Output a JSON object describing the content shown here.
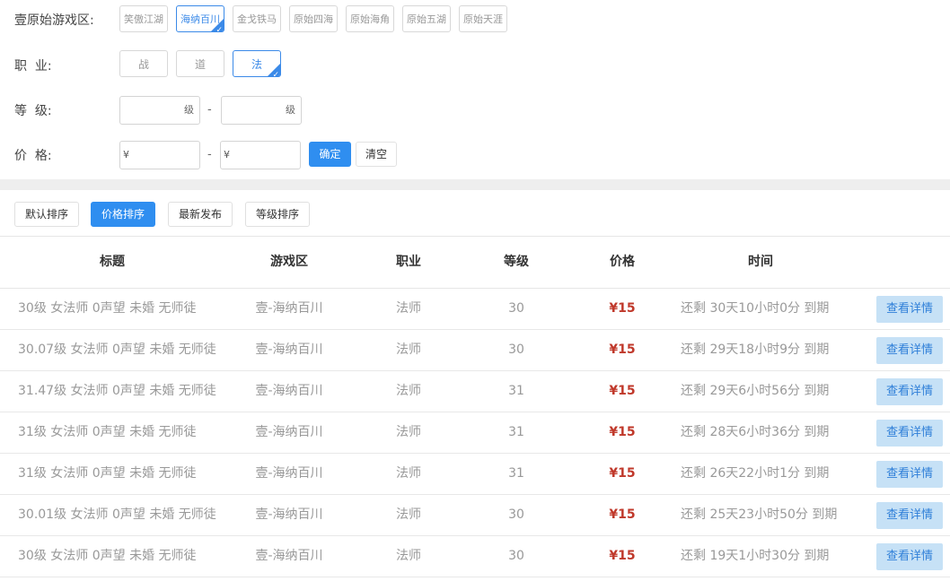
{
  "filters": {
    "zone_label": "壹原始游戏区:",
    "zones": [
      {
        "label": "笑傲江湖",
        "selected": false
      },
      {
        "label": "海纳百川",
        "selected": true
      },
      {
        "label": "金戈铁马",
        "selected": false
      },
      {
        "label": "原始四海",
        "selected": false
      },
      {
        "label": "原始海角",
        "selected": false
      },
      {
        "label": "原始五湖",
        "selected": false
      },
      {
        "label": "原始天涯",
        "selected": false
      }
    ],
    "job_label": "职  业:",
    "jobs": [
      {
        "label": "战",
        "selected": false
      },
      {
        "label": "道",
        "selected": false
      },
      {
        "label": "法",
        "selected": true
      }
    ],
    "level_label": "等  级:",
    "level_unit": "级",
    "level_min": "",
    "level_max": "",
    "price_label": "价  格:",
    "currency": "¥",
    "price_min": "",
    "price_max": "",
    "range_sep": "-",
    "confirm": "确定",
    "clear": "清空",
    "check": "✓"
  },
  "sort": {
    "buttons": [
      {
        "label": "默认排序",
        "active": false
      },
      {
        "label": "价格排序",
        "active": true
      },
      {
        "label": "最新发布",
        "active": false
      },
      {
        "label": "等级排序",
        "active": false
      }
    ]
  },
  "table": {
    "headers": {
      "title": "标题",
      "zone": "游戏区",
      "job": "职业",
      "level": "等级",
      "price": "价格",
      "time": "时间"
    },
    "detail_label": "查看详情",
    "rows": [
      {
        "title": "30级 女法师 0声望 未婚 无师徒",
        "zone": "壹-海纳百川",
        "job": "法师",
        "level": "30",
        "price": "¥15",
        "time": "还剩 30天10小时0分 到期"
      },
      {
        "title": "30.07级 女法师 0声望 未婚 无师徒",
        "zone": "壹-海纳百川",
        "job": "法师",
        "level": "30",
        "price": "¥15",
        "time": "还剩 29天18小时9分 到期"
      },
      {
        "title": "31.47级 女法师 0声望 未婚 无师徒",
        "zone": "壹-海纳百川",
        "job": "法师",
        "level": "31",
        "price": "¥15",
        "time": "还剩 29天6小时56分 到期"
      },
      {
        "title": "31级 女法师 0声望 未婚 无师徒",
        "zone": "壹-海纳百川",
        "job": "法师",
        "level": "31",
        "price": "¥15",
        "time": "还剩 28天6小时36分 到期"
      },
      {
        "title": "31级 女法师 0声望 未婚 无师徒",
        "zone": "壹-海纳百川",
        "job": "法师",
        "level": "31",
        "price": "¥15",
        "time": "还剩 26天22小时1分 到期"
      },
      {
        "title": "30.01级 女法师 0声望 未婚 无师徒",
        "zone": "壹-海纳百川",
        "job": "法师",
        "level": "30",
        "price": "¥15",
        "time": "还剩 25天23小时50分 到期"
      },
      {
        "title": "30级 女法师 0声望 未婚 无师徒",
        "zone": "壹-海纳百川",
        "job": "法师",
        "level": "30",
        "price": "¥15",
        "time": "还剩 19天1小时30分 到期"
      }
    ]
  },
  "colors": {
    "accent": "#2f8ef0",
    "price": "#c0392b",
    "detail_bg": "#c6e1f6"
  }
}
